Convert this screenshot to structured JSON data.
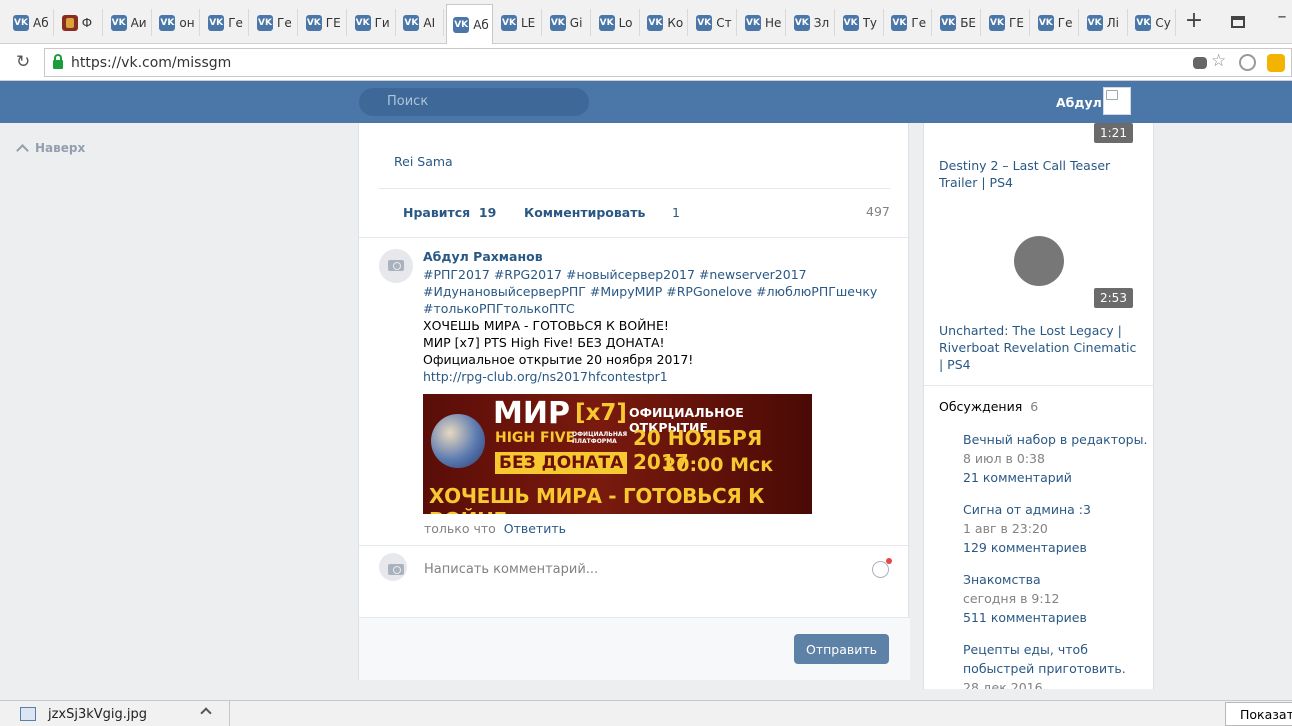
{
  "browser": {
    "tabs": [
      {
        "label": "Аб",
        "icon": "vk-icon"
      },
      {
        "label": "Ф",
        "icon": "crest-icon"
      },
      {
        "label": "Аи",
        "icon": "vk-icon"
      },
      {
        "label": "он",
        "icon": "vk-icon"
      },
      {
        "label": "Ге",
        "icon": "vk-icon"
      },
      {
        "label": "Ге",
        "icon": "vk-icon"
      },
      {
        "label": "ГЕ",
        "icon": "vk-icon"
      },
      {
        "label": "Ги",
        "icon": "vk-icon"
      },
      {
        "label": "АІ",
        "icon": "vk-icon"
      },
      {
        "label": "Аб",
        "icon": "vk-icon",
        "active": true
      },
      {
        "label": "LE",
        "icon": "vk-icon"
      },
      {
        "label": "Gi",
        "icon": "vk-icon"
      },
      {
        "label": "Lo",
        "icon": "vk-icon"
      },
      {
        "label": "Ко",
        "icon": "vk-icon"
      },
      {
        "label": "Ст",
        "icon": "vk-icon"
      },
      {
        "label": "Не",
        "icon": "vk-icon"
      },
      {
        "label": "Зл",
        "icon": "vk-icon"
      },
      {
        "label": "Ту",
        "icon": "vk-icon"
      },
      {
        "label": "Ге",
        "icon": "vk-icon"
      },
      {
        "label": "БЕ",
        "icon": "vk-icon"
      },
      {
        "label": "ГЕ",
        "icon": "vk-icon"
      },
      {
        "label": "Ге",
        "icon": "vk-icon"
      },
      {
        "label": "Лі",
        "icon": "vk-icon"
      },
      {
        "label": "Су",
        "icon": "vk-icon"
      }
    ],
    "new_tab": "+",
    "url": "https://vk.com/missgm"
  },
  "vk": {
    "search_placeholder": "Поиск",
    "user_name": "Абдул",
    "scroll_top": "Наверх"
  },
  "post": {
    "prev_comment_author": "Rei Sama",
    "likes_label": "Нравится",
    "likes_count": "19",
    "comment_label": "Комментировать",
    "comment_count": "1",
    "views": "497",
    "comment": {
      "author": "Абдул Рахманов",
      "hashtags_line1": "#РПГ2017 #RPG2017 #новыйсервер2017 #newserver2017",
      "hashtags_line2": "#ИдунановыйсерверРПГ #МируМИР #RPGonelove #люблюРПГшечку",
      "hashtags_line3": "#толькоРПГтолькоПТС",
      "line1": "ХОЧЕШЬ МИРА - ГОТОВЬСЯ К ВОЙНЕ!",
      "line2": "МИР [x7] PTS High Five! БЕЗ ДОНАТА!",
      "line3": "Официальное открытие 20 ноября 2017!",
      "link": "http://rpg-club.org/ns2017hfcontestpr1",
      "time": "только что",
      "reply": "Ответить",
      "banner": {
        "mir": "МИР",
        "x7": "[x7]",
        "high_five": "HIGH FIVE",
        "platform": "ОФИЦИАЛЬНАЯ ПЛАТФОРМА",
        "no_donate": "БЕЗ ДОНАТА",
        "opening": "ОФИЦИАЛЬНОЕ ОТКРЫТИЕ",
        "date": "20 НОЯБРЯ 2017",
        "time": "20:00 Мск",
        "slogan": "ХОЧЕШЬ МИРА - ГОТОВЬСЯ К ВОЙНЕ"
      }
    },
    "new_comment_placeholder": "Написать комментарий...",
    "send": "Отправить"
  },
  "sidebar": {
    "video1_duration": "1:21",
    "video1_title": "Destiny 2 – Last Call Teaser Trailer | PS4",
    "video2_duration": "2:53",
    "video2_title": "Uncharted: The Lost Legacy | Riverboat Revelation Cinematic | PS4",
    "discussions_label": "Обсуждения",
    "discussions_count": "6",
    "topics": [
      {
        "title": "Вечный набор в редакторы.",
        "date": "8 июл в 0:38",
        "comments": "21 комментарий"
      },
      {
        "title": "Сигна от админа :3",
        "date": "1 авг в 23:20",
        "comments": "129 комментариев"
      },
      {
        "title": "Знакомства",
        "date": "сегодня в 9:12",
        "comments": "511 комментариев"
      },
      {
        "title": "Рецепты еды, чтоб побыстрей приготовить.",
        "date": "28 дек 2016",
        "comments": ""
      }
    ]
  },
  "downloads": {
    "file": "jzxSj3kVgig.jpg",
    "show_all": "Показать"
  }
}
